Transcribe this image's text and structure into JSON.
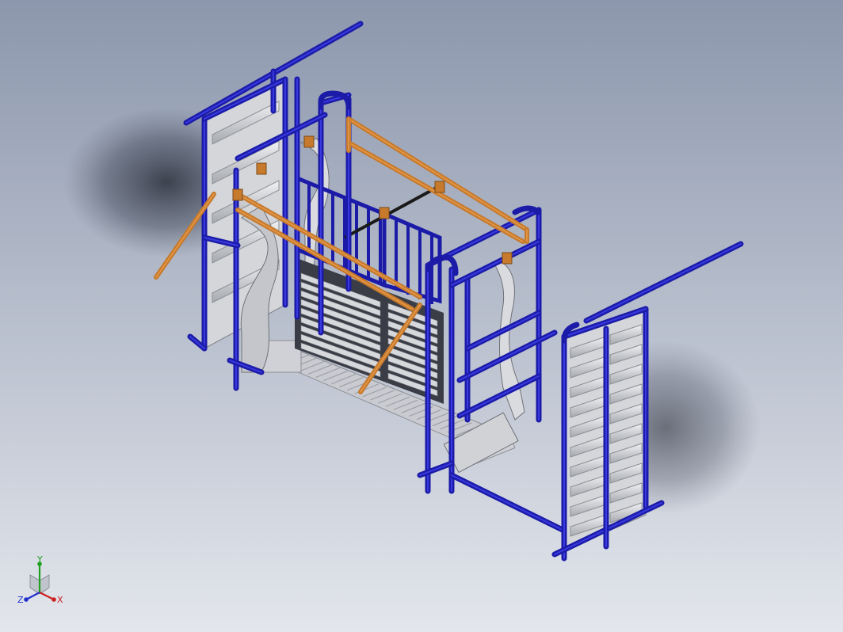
{
  "viewport": {
    "background_top": "#8c97ad",
    "background_bottom": "#e3e6ec"
  },
  "model": {
    "frame_color": "#1b1ba8",
    "frame_highlight": "#3a3ae0",
    "lever_color": "#c77a2c",
    "lever_highlight": "#e69a4c",
    "panel_color": "#d7d9dd",
    "panel_shade": "#9a9da3",
    "axle_color": "#1a1a1a"
  },
  "triad": {
    "x_label": "X",
    "y_label": "Y",
    "z_label": "Z",
    "x_color": "#cc2020",
    "y_color": "#20a020",
    "z_color": "#2030cc"
  }
}
